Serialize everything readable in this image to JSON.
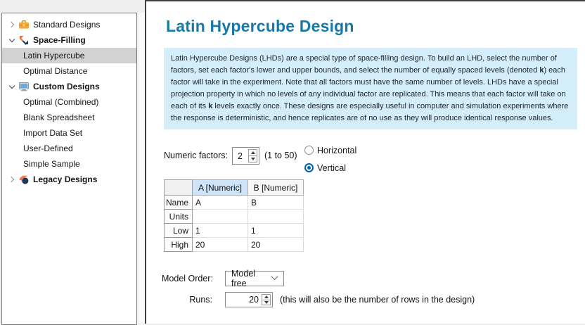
{
  "sidebar": {
    "items": [
      {
        "label": "Standard Designs",
        "icon": "toolbox",
        "expanded": false
      },
      {
        "label": "Space-Filling",
        "icon": "space-filling",
        "expanded": true
      },
      {
        "label": "Latin Hypercube",
        "selected": true
      },
      {
        "label": "Optimal Distance"
      },
      {
        "label": "Custom Designs",
        "icon": "computer",
        "expanded": true
      },
      {
        "label": "Optimal (Combined)"
      },
      {
        "label": "Blank Spreadsheet"
      },
      {
        "label": "Import Data Set"
      },
      {
        "label": "User-Defined"
      },
      {
        "label": "Simple Sample"
      },
      {
        "label": "Legacy Designs",
        "icon": "pin",
        "expanded": false
      }
    ]
  },
  "main": {
    "title": "Latin Hypercube Design",
    "description": "Latin Hypercube Designs (LHDs) are a special type of space-filling design. To build an LHD, select the number of factors, set each factor's lower and upper bounds, and select the number of equally spaced levels (denoted **k**) each factor will take in the experiment. Note that all factors must have the same number of levels. LHDs have a special projection property in which no levels of any individual factor are replicated. This means that each factor will take on each of its **k** levels exactly once. These designs are especially useful in computer and simulation experiments where the response is deterministic, and hence replicates are of no use as they will produce identical response values.",
    "numeric_factors": {
      "label": "Numeric factors:",
      "value": "2",
      "range_hint": "(1 to 50)"
    },
    "orientation": {
      "options": [
        {
          "label": "Horizontal",
          "selected": false
        },
        {
          "label": "Vertical",
          "selected": true
        }
      ]
    },
    "factor_table": {
      "corner": "",
      "columns": [
        "A [Numeric]",
        "B [Numeric]"
      ],
      "rows": [
        {
          "header": "Name",
          "cells": [
            "A",
            "B"
          ]
        },
        {
          "header": "Units",
          "cells": [
            "",
            ""
          ]
        },
        {
          "header": "Low",
          "cells": [
            "1",
            "1"
          ]
        },
        {
          "header": "High",
          "cells": [
            "20",
            "20"
          ]
        }
      ]
    },
    "model_order": {
      "label": "Model Order:",
      "value": "Model free"
    },
    "runs": {
      "label": "Runs:",
      "value": "20",
      "hint": "(this will also be the number of rows in the design)"
    }
  },
  "colors": {
    "title_blue": "#1878A8",
    "info_bg": "#D3EDF9",
    "radio_blue": "#0063B1",
    "selected_tree_item_bg": "#D2D2D2",
    "selected_column_bg": "#CFE4F8"
  }
}
